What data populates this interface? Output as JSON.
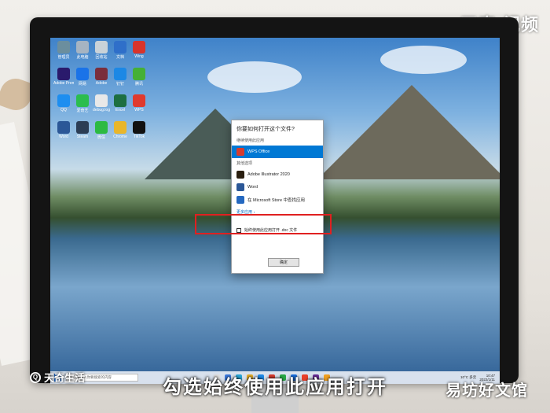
{
  "watermarks": {
    "top_right": "天奇·视频",
    "bottom_left": "天奇生活",
    "bottom_right": "易坊好文馆"
  },
  "subtitle": "勾选始终使用此应用打开",
  "desktop_icons": [
    {
      "label": "管理员",
      "color": "#6b8e9e"
    },
    {
      "label": "此电脑",
      "color": "#a6b4c2"
    },
    {
      "label": "回收站",
      "color": "#c9d2d8"
    },
    {
      "label": "文档",
      "color": "#2f6fc9"
    },
    {
      "label": "Wing",
      "color": "#d8342c"
    },
    {
      "label": "Adobe Premiere",
      "color": "#2a1a6c"
    },
    {
      "label": "网易",
      "color": "#1a73e8"
    },
    {
      "label": "Adobe",
      "color": "#7a2e3c"
    },
    {
      "label": "钉钉",
      "color": "#1c88e5"
    },
    {
      "label": "腾讯",
      "color": "#45b035"
    },
    {
      "label": "QQ",
      "color": "#1d8ef0"
    },
    {
      "label": "爱奇艺",
      "color": "#2bbd4f"
    },
    {
      "label": "debug.log",
      "color": "#e8e8e8"
    },
    {
      "label": "Excel",
      "color": "#1d6f42"
    },
    {
      "label": "WPS",
      "color": "#e03a2e"
    },
    {
      "label": "Word",
      "color": "#2b5797"
    },
    {
      "label": "Steam",
      "color": "#2b3d55"
    },
    {
      "label": "微信",
      "color": "#2cba42"
    },
    {
      "label": "Chrome",
      "color": "#e9b62a"
    },
    {
      "label": "TikTok",
      "color": "#111111"
    }
  ],
  "dialog": {
    "title": "你要如何打开这个文件?",
    "keep_label": "继续使用此应用",
    "selected_app": "WPS Office",
    "other_label": "其他选项",
    "apps": [
      {
        "name": "Adobe Illustrator 2020",
        "color": "#2a1f10"
      },
      {
        "name": "Word",
        "color": "#2b5797"
      },
      {
        "name": "在 Microsoft Store 中查找应用",
        "color": "#2468c0"
      }
    ],
    "more_apps": "更多应用 ↓",
    "always_use": "始终使用此应用打开 .doc 文件",
    "ok_button": "确定"
  },
  "taskbar": {
    "search_placeholder": "在这里输入你要搜索的内容",
    "weather": "10°C 多云",
    "time": "10:47",
    "date": "2022/1/11",
    "apps": [
      "#e0e0e0",
      "#3c7be0",
      "#2aa6d6",
      "#e8b02a",
      "#1e88e5",
      "#d63b2f",
      "#28a745",
      "#1a73e8",
      "#e8402a",
      "#6d2e9c",
      "#f0a020"
    ]
  }
}
